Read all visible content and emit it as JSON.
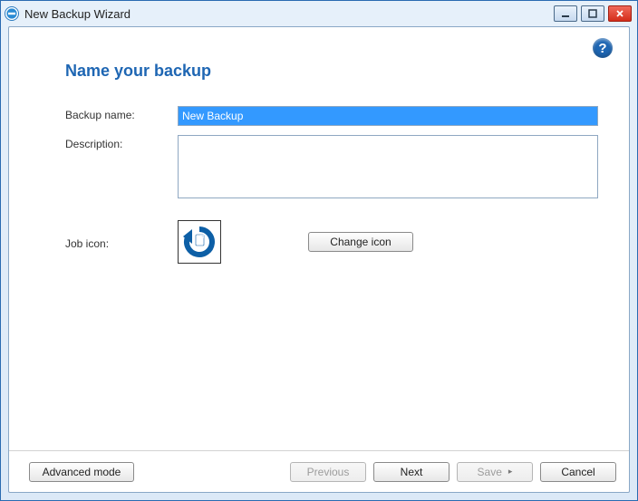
{
  "window": {
    "title": "New Backup Wizard"
  },
  "page": {
    "heading": "Name your backup"
  },
  "form": {
    "backup_name_label": "Backup name:",
    "backup_name_value": "New Backup",
    "description_label": "Description:",
    "description_value": "",
    "job_icon_label": "Job icon:",
    "change_icon_label": "Change icon"
  },
  "footer": {
    "advanced_label": "Advanced mode",
    "previous_label": "Previous",
    "next_label": "Next",
    "save_label": "Save",
    "cancel_label": "Cancel"
  }
}
